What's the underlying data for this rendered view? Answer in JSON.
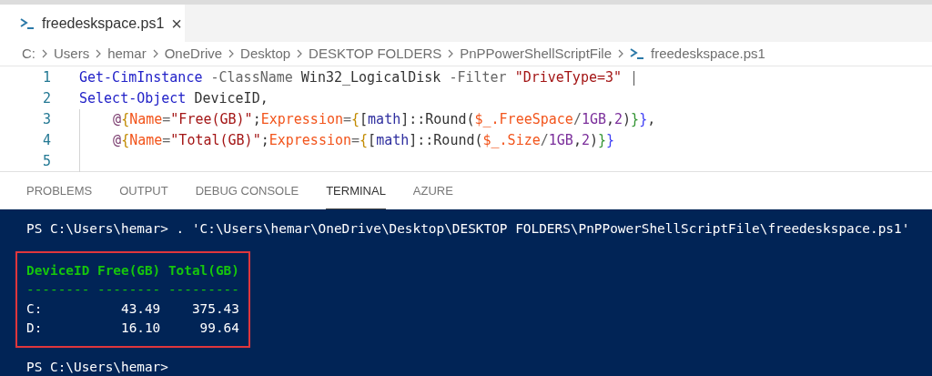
{
  "editor_tab": {
    "label": "freedeskspace.ps1",
    "close": "×",
    "selected": true
  },
  "breadcrumb": [
    "C:",
    "Users",
    "hemar",
    "OneDrive",
    "Desktop",
    "DESKTOP FOLDERS",
    "PnPPowerShellScriptFile",
    "freedeskspace.ps1"
  ],
  "code_lines": [
    {
      "number": "1",
      "tokens": [
        {
          "text": "Get-CimInstance ",
          "kind": "command"
        },
        {
          "text": "-ClassName",
          "kind": "parameter"
        },
        {
          "text": " Win32_LogicalDisk ",
          "kind": "plain"
        },
        {
          "text": "-Filter ",
          "kind": "parameter"
        },
        {
          "text": "\"DriveType=3\"",
          "kind": "string"
        },
        {
          "text": " |",
          "kind": "parameter"
        }
      ]
    },
    {
      "number": "2",
      "tokens": [
        {
          "text": "Select-Object",
          "kind": "command"
        },
        {
          "text": " DeviceID,",
          "kind": "plain"
        }
      ]
    },
    {
      "number": "3",
      "tokens": [
        {
          "text": "    @",
          "kind": "at"
        },
        {
          "text": "{",
          "kind": "brace1"
        },
        {
          "text": "Name",
          "kind": "variable"
        },
        {
          "text": "=",
          "kind": "parameter"
        },
        {
          "text": "\"Free(GB)\"",
          "kind": "string"
        },
        {
          "text": ";",
          "kind": "plain"
        },
        {
          "text": "Expression",
          "kind": "variable"
        },
        {
          "text": "=",
          "kind": "parameter"
        },
        {
          "text": "{",
          "kind": "brace1"
        },
        {
          "text": "[",
          "kind": "plain"
        },
        {
          "text": "math",
          "kind": "type"
        },
        {
          "text": "]::Round(",
          "kind": "plain"
        },
        {
          "text": "$_.FreeSpace",
          "kind": "variable"
        },
        {
          "text": "/",
          "kind": "parameter"
        },
        {
          "text": "1GB",
          "kind": "number"
        },
        {
          "text": ",",
          "kind": "plain"
        },
        {
          "text": "2",
          "kind": "number"
        },
        {
          "text": ")",
          "kind": "plain"
        },
        {
          "text": "}",
          "kind": "brace2"
        },
        {
          "text": "}",
          "kind": "brace3"
        },
        {
          "text": ",",
          "kind": "plain"
        }
      ]
    },
    {
      "number": "4",
      "tokens": [
        {
          "text": "    @",
          "kind": "at"
        },
        {
          "text": "{",
          "kind": "brace1"
        },
        {
          "text": "Name",
          "kind": "variable"
        },
        {
          "text": "=",
          "kind": "parameter"
        },
        {
          "text": "\"Total(GB)\"",
          "kind": "string"
        },
        {
          "text": ";",
          "kind": "plain"
        },
        {
          "text": "Expression",
          "kind": "variable"
        },
        {
          "text": "=",
          "kind": "parameter"
        },
        {
          "text": "{",
          "kind": "brace1"
        },
        {
          "text": "[",
          "kind": "plain"
        },
        {
          "text": "math",
          "kind": "type"
        },
        {
          "text": "]::Round(",
          "kind": "plain"
        },
        {
          "text": "$_.Size",
          "kind": "variable"
        },
        {
          "text": "/",
          "kind": "parameter"
        },
        {
          "text": "1GB",
          "kind": "number"
        },
        {
          "text": ",",
          "kind": "plain"
        },
        {
          "text": "2",
          "kind": "number"
        },
        {
          "text": ")",
          "kind": "plain"
        },
        {
          "text": "}",
          "kind": "brace2"
        },
        {
          "text": "}",
          "kind": "brace3"
        }
      ]
    },
    {
      "number": "5"
    }
  ],
  "panel_tabs": [
    {
      "label": "PROBLEMS",
      "selected": false
    },
    {
      "label": "OUTPUT",
      "selected": false
    },
    {
      "label": "DEBUG CONSOLE",
      "selected": false
    },
    {
      "label": "TERMINAL",
      "selected": true
    },
    {
      "label": "AZURE",
      "selected": false
    }
  ],
  "terminal": {
    "command_line": "PS C:\\Users\\hemar> . 'C:\\Users\\hemar\\OneDrive\\Desktop\\DESKTOP FOLDERS\\PnPPowerShellScriptFile\\freedeskspace.ps1'",
    "output_lines": [
      {
        "text": "DeviceID Free(GB) Total(GB)",
        "kind": "header"
      },
      {
        "text": "-------- -------- ---------",
        "kind": "rule"
      },
      {
        "text": "C:          43.49    375.43",
        "kind": "row"
      },
      {
        "text": "D:          16.10     99.64",
        "kind": "row"
      }
    ],
    "prompt": "PS C:\\Users\\hemar>"
  }
}
